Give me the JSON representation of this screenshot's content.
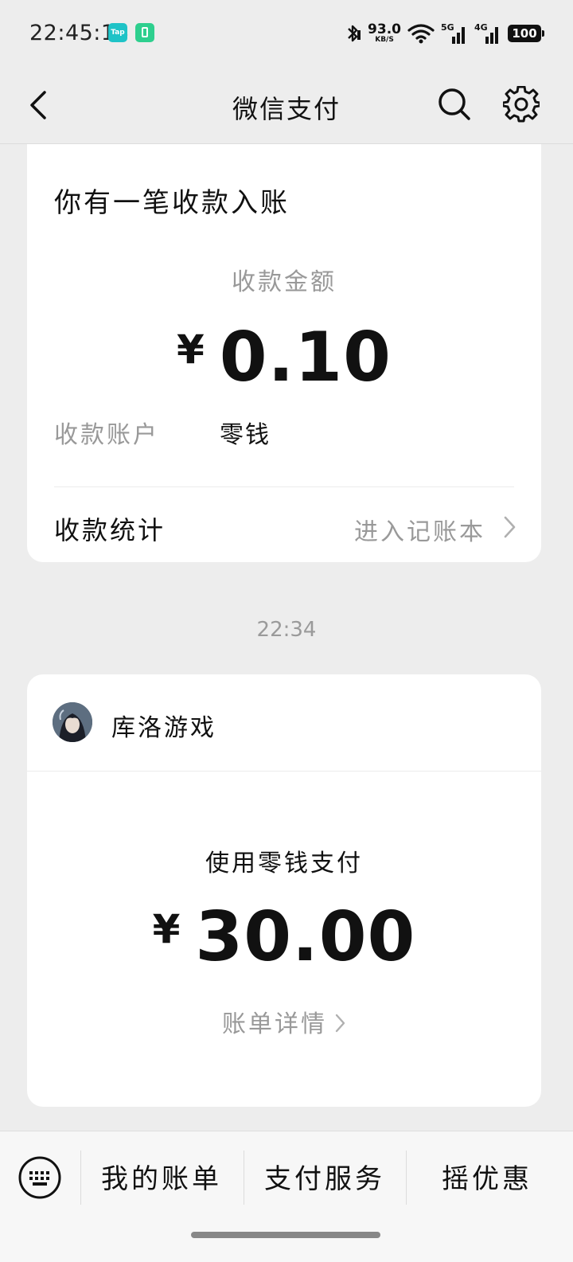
{
  "status_bar": {
    "time": "22:45:16",
    "tap_label": "Tap",
    "net_speed": "93.0",
    "net_unit": "KB/S",
    "net1": "5G",
    "net2": "4G",
    "battery": "100"
  },
  "header": {
    "title": "微信支付"
  },
  "income_card": {
    "heading": "你有一笔收款入账",
    "amount_label": "收款金额",
    "currency": "¥",
    "amount": "0.10",
    "account_label": "收款账户",
    "account_value": "零钱",
    "stats_label": "收款统计",
    "stats_link": "进入记账本"
  },
  "timestamp": "22:34",
  "payment_card": {
    "merchant": "库洛游戏",
    "pay_method": "使用零钱支付",
    "currency": "¥",
    "amount": "30.00",
    "detail_link": "账单详情"
  },
  "bottom_bar": {
    "items": [
      "我的账单",
      "支付服务",
      "摇优惠"
    ]
  },
  "colors": {
    "background": "#ededed",
    "card": "#ffffff",
    "secondary_text": "#999999"
  }
}
